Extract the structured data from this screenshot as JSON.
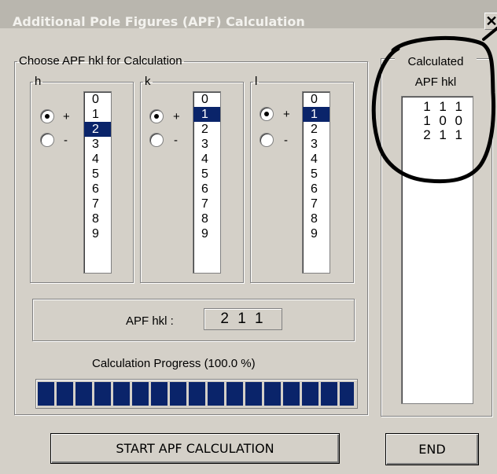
{
  "window": {
    "title": "Additional Pole Figures (APF) Calculation",
    "close_glyph": "✕"
  },
  "choose": {
    "legend": "Choose APF hkl for Calculation",
    "groups": [
      {
        "legend": "h",
        "plus": "+",
        "minus": "-",
        "sign": "+",
        "options": [
          "0",
          "1",
          "2",
          "3",
          "4",
          "5",
          "6",
          "7",
          "8",
          "9"
        ],
        "selected": "2"
      },
      {
        "legend": "k",
        "plus": "+",
        "minus": "-",
        "sign": "+",
        "options": [
          "0",
          "1",
          "2",
          "3",
          "4",
          "5",
          "6",
          "7",
          "8",
          "9"
        ],
        "selected": "1"
      },
      {
        "legend": "l",
        "plus": "+",
        "minus": "-",
        "sign": "+",
        "options": [
          "0",
          "1",
          "2",
          "3",
          "4",
          "5",
          "6",
          "7",
          "8",
          "9"
        ],
        "selected": "1"
      }
    ]
  },
  "apf": {
    "label": "APF hkl :",
    "value": "2 1 1"
  },
  "progress": {
    "label": "Calculation Progress   (100.0 %)",
    "fraction": 1.0
  },
  "start_button": "START APF CALCULATION",
  "calculated": {
    "legend_line1": "Calculated",
    "legend_line2": "APF hkl",
    "items": [
      "1 1 1",
      "1 0 0",
      "2 1 1"
    ]
  },
  "end_button": "END",
  "colors": {
    "selection": "#0a246a",
    "face": "#d4d0c8",
    "titlebar": "#b9b6ae"
  }
}
